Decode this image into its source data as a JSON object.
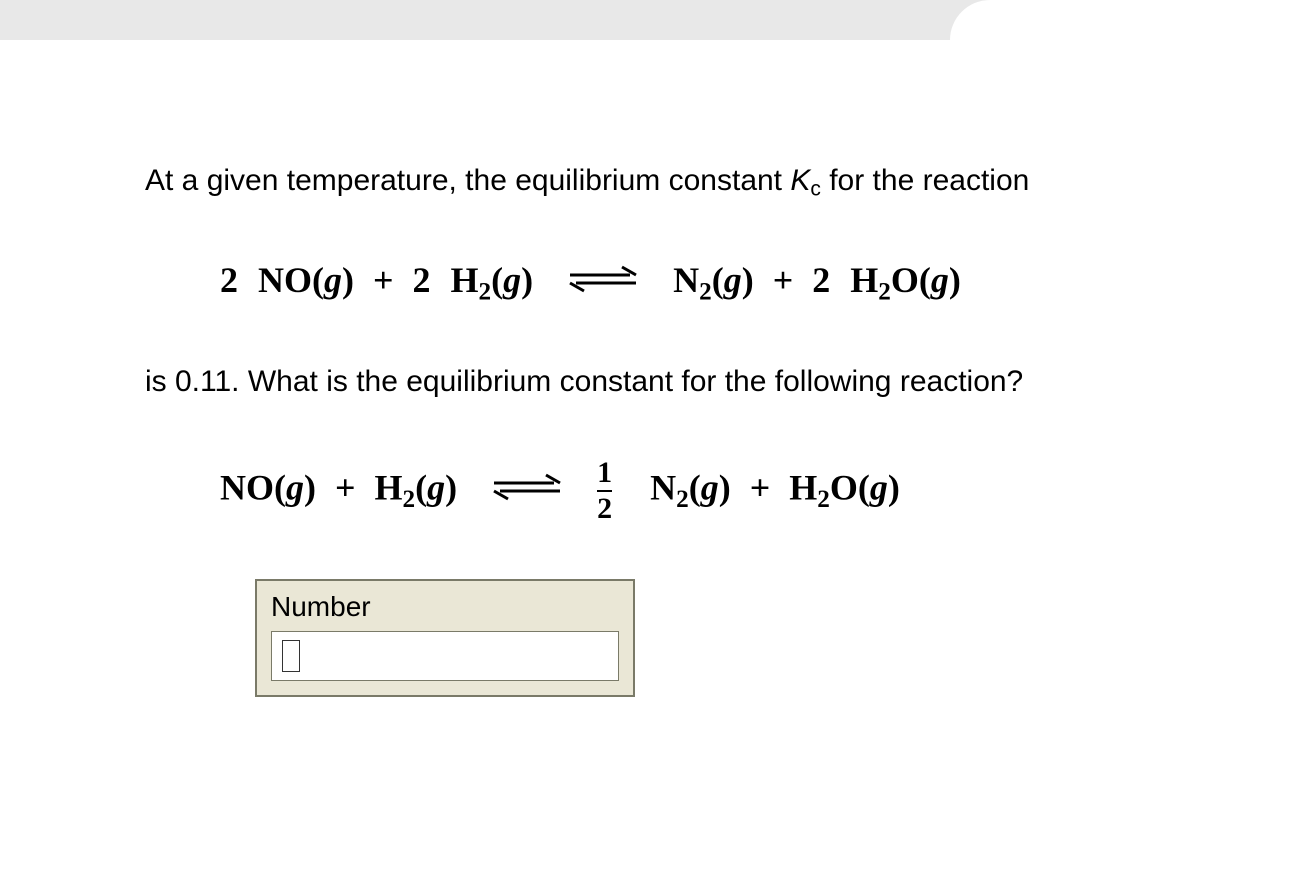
{
  "question": {
    "intro": "At a given temperature, the equilibrium constant ",
    "k_symbol": "K",
    "k_sub": "c",
    "intro_tail": " for the reaction",
    "value_line_pre": "is ",
    "kc_value": "0.11",
    "value_line_post": ". What is the equilibrium constant for the following reaction?"
  },
  "equation1": {
    "c_no": "2",
    "sp_no": "NO",
    "g": "g",
    "plus": "+",
    "c_h2": "2",
    "sp_h2_a": "H",
    "sp_h2_sub": "2",
    "sp_n2_a": "N",
    "sp_n2_sub": "2",
    "c_h2o": "2",
    "sp_h2o_a": "H",
    "sp_h2o_sub": "2",
    "sp_h2o_b": "O"
  },
  "equation2": {
    "sp_no": "NO",
    "g": "g",
    "plus": "+",
    "sp_h2_a": "H",
    "sp_h2_sub": "2",
    "frac_num": "1",
    "frac_den": "2",
    "sp_n2_a": "N",
    "sp_n2_sub": "2",
    "sp_h2o_a": "H",
    "sp_h2o_sub": "2",
    "sp_h2o_b": "O"
  },
  "answer": {
    "label": "Number",
    "value": ""
  }
}
